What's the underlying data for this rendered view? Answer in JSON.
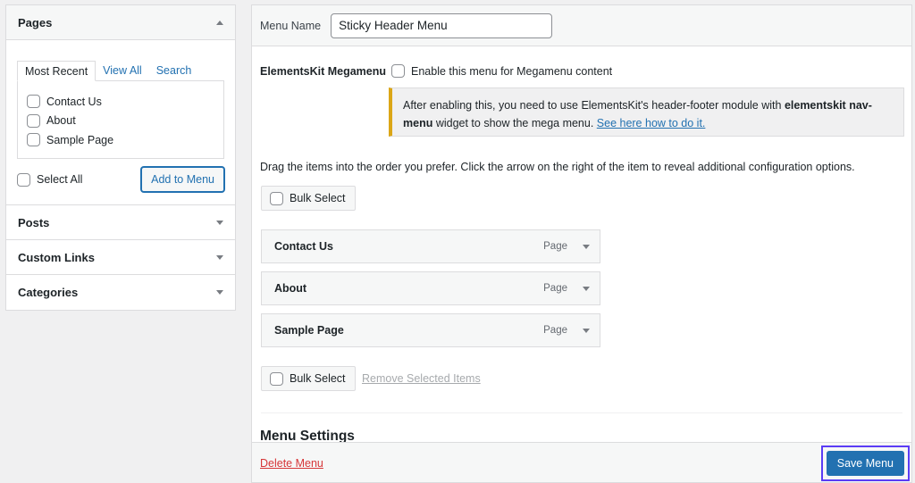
{
  "left_panel": {
    "pages": {
      "title": "Pages",
      "tabs": [
        {
          "label": "Most Recent",
          "active": true
        },
        {
          "label": "View All",
          "active": false
        },
        {
          "label": "Search",
          "active": false
        }
      ],
      "items": [
        {
          "label": "Contact Us",
          "checked": false
        },
        {
          "label": "About",
          "checked": false
        },
        {
          "label": "Sample Page",
          "checked": false
        }
      ],
      "select_all_label": "Select All",
      "add_button": "Add to Menu"
    },
    "sections": [
      {
        "title": "Posts"
      },
      {
        "title": "Custom Links"
      },
      {
        "title": "Categories"
      }
    ]
  },
  "menu_editor": {
    "menu_name_label": "Menu Name",
    "menu_name_value": "Sticky Header Menu",
    "megamenu": {
      "label": "ElementsKit Megamenu",
      "checkbox_label": "Enable this menu for Megamenu content",
      "checked": false
    },
    "notice": {
      "text_before": "After enabling this, you need to use ElementsKit's header-footer module with ",
      "bold1": "elementskit nav-menu",
      "text_middle": " widget to show the mega menu. ",
      "link": "See here how to do it.",
      "accent_color": "#dba617"
    },
    "instructions": "Drag the items into the order you prefer. Click the arrow on the right of the item to reveal additional configuration options.",
    "bulk_select_label": "Bulk Select",
    "menu_items": [
      {
        "title": "Contact Us",
        "type": "Page"
      },
      {
        "title": "About",
        "type": "Page"
      },
      {
        "title": "Sample Page",
        "type": "Page"
      }
    ],
    "remove_selected_label": "Remove Selected Items",
    "settings_heading": "Menu Settings",
    "delete_link": "Delete Menu",
    "save_button": "Save Menu",
    "colors": {
      "primary": "#2271b1",
      "delete": "#d63638",
      "highlight": "#5b3cf5"
    }
  }
}
